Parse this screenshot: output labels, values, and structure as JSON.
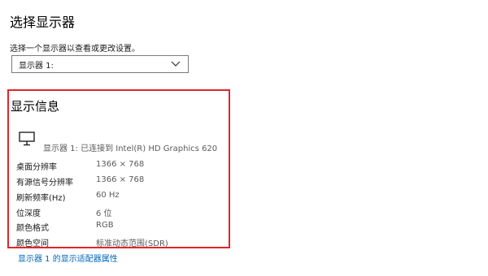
{
  "select_display": {
    "title": "选择显示器",
    "description": "选择一个显示器以查看或更改设置。",
    "dropdown_value": "显示器 1:"
  },
  "display_info": {
    "title": "显示信息",
    "adapter": "显示器 1: 已连接到 Intel(R) HD Graphics 620",
    "rows": [
      {
        "label": "桌面分辨率",
        "value": "1366 × 768"
      },
      {
        "label": "有源信号分辨率",
        "value": "1366 × 768"
      },
      {
        "label": "刷新频率(Hz)",
        "value": "60 Hz"
      },
      {
        "label": "位深度",
        "value": "6 位"
      },
      {
        "label": "颜色格式",
        "value": "RGB"
      },
      {
        "label": "颜色空间",
        "value": "标准动态范围(SDR)"
      }
    ]
  },
  "adapter_link": "显示器 1 的显示适配器属性",
  "colors": {
    "highlight_border": "#e0262b",
    "link": "#0067b8"
  }
}
